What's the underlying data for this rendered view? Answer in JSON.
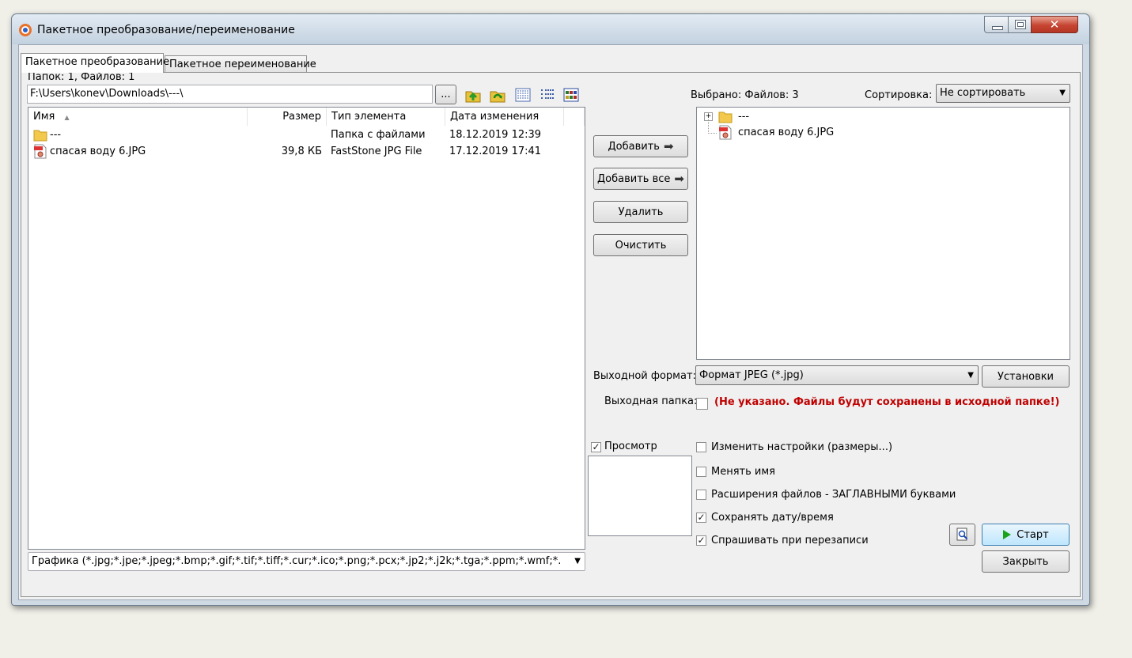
{
  "window": {
    "title": "Пакетное преобразование/переименование"
  },
  "tabs": [
    {
      "label": "Пакетное преобразование",
      "active": true
    },
    {
      "label": "Пакетное переименование",
      "active": false
    }
  ],
  "left": {
    "counts": "Папок: 1, Файлов: 1",
    "path": "F:\\Users\\konev\\Downloads\\---\\",
    "browse_label": "...",
    "columns": [
      "Имя",
      "Размер",
      "Тип элемента",
      "Дата изменения"
    ],
    "rows": [
      {
        "name": "---",
        "size": "",
        "type": "Папка с файлами",
        "date": "18.12.2019 12:39",
        "icon": "folder-icon"
      },
      {
        "name": "спасая  воду  6.JPG",
        "size": "39,8 КБ",
        "type": "FastStone JPG File",
        "date": "17.12.2019 17:41",
        "icon": "jpg-file-icon"
      }
    ],
    "filter": "Графика (*.jpg;*.jpe;*.jpeg;*.bmp;*.gif;*.tif;*.tiff;*.cur;*.ico;*.png;*.pcx;*.jp2;*.j2k;*.tga;*.ppm;*.wmf;*."
  },
  "middle": {
    "add": "Добавить",
    "add_all": "Добавить все",
    "remove": "Удалить",
    "clear": "Очистить",
    "arrow": "➡"
  },
  "right": {
    "selected": "Выбрано:  Файлов: 3",
    "sort_label": "Сортировка:",
    "sort_value": "Не сортировать",
    "tree": [
      {
        "label": "---",
        "icon": "folder-icon",
        "expander": "+"
      },
      {
        "label": "спасая  воду  6.JPG",
        "icon": "jpg-file-icon"
      }
    ]
  },
  "output": {
    "format_label": "Выходной формат:",
    "format_value": "Формат JPEG (*.jpg)",
    "settings": "Установки",
    "folder_label": "Выходная папка:",
    "folder_warning": "(Не указано. Файлы будут сохранены в исходной папке!)"
  },
  "options": {
    "preview": {
      "label": "Просмотр",
      "checked": true
    },
    "change_settings": {
      "label": "Изменить настройки (размеры...)",
      "checked": false
    },
    "rename": {
      "label": "Менять имя",
      "checked": false
    },
    "uppercase_ext": {
      "label": "Расширения файлов - ЗАГЛАВНЫМИ буквами",
      "checked": false
    },
    "keep_date": {
      "label": "Сохранять дату/время",
      "checked": true
    },
    "ask_overwrite": {
      "label": "Спрашивать при перезаписи",
      "checked": true
    }
  },
  "actions": {
    "start": "Старт",
    "close": "Закрыть",
    "check_mark": "✓",
    "close_glyph": "✕",
    "dropdown_glyph": "▼",
    "sort_glyph": "▲"
  },
  "colors": {
    "warning": "#c00000",
    "start_arrow": "#1aa31a",
    "folder": "#f2c94c"
  }
}
